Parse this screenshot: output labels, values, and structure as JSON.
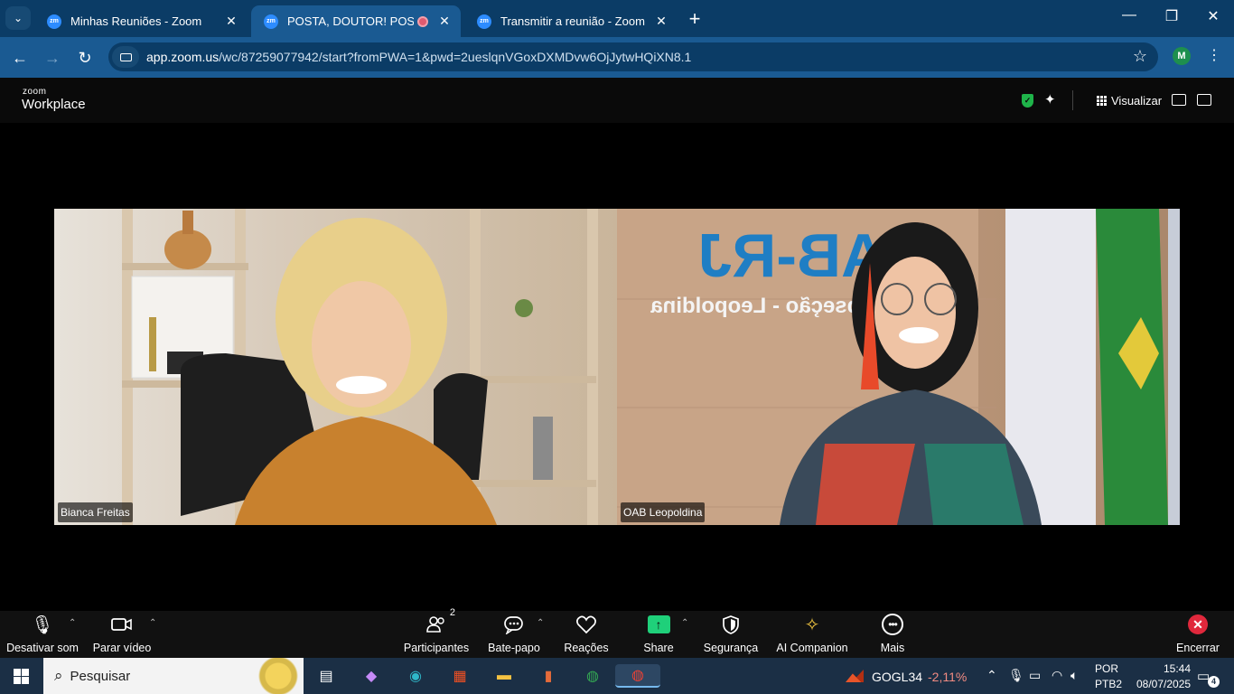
{
  "browser": {
    "tabs": [
      {
        "title": "Minhas Reuniões - Zoom",
        "favicon": "zm"
      },
      {
        "title": "POSTA, DOUTOR! POSICION",
        "favicon": "zm"
      },
      {
        "title": "Transmitir a reunião - Zoom",
        "favicon": "zm"
      }
    ],
    "url_host": "app.zoom.us",
    "url_path": "/wc/87259077942/start?fromPWA=1&pwd=2ueslqnVGoxDXMDvw6OjJytwHQiXN8.1",
    "profile_initial": "M"
  },
  "zoom_header": {
    "logo_top": "zoom",
    "logo_bottom": "Workplace",
    "view_label": "Visualizar",
    "shield_color": "#1fb44a"
  },
  "participants": [
    {
      "name": "Bianca Freitas"
    },
    {
      "name": "OAB Leopoldina"
    }
  ],
  "controls": {
    "mute": "Desativar som",
    "video": "Parar vídeo",
    "participants": "Participantes",
    "participants_count": "2",
    "chat": "Bate-papo",
    "reactions": "Reações",
    "share": "Share",
    "security": "Segurança",
    "ai": "AI Companion",
    "more": "Mais",
    "end": "Encerrar",
    "share_color": "#1fd07a",
    "end_color": "#e0283c"
  },
  "taskbar": {
    "search_placeholder": "Pesquisar",
    "stock_symbol": "GOGL34",
    "stock_change": "-2,11%",
    "lang_line1": "POR",
    "lang_line2": "PTB2",
    "time": "15:44",
    "date": "08/07/2025",
    "notifications": "4"
  }
}
